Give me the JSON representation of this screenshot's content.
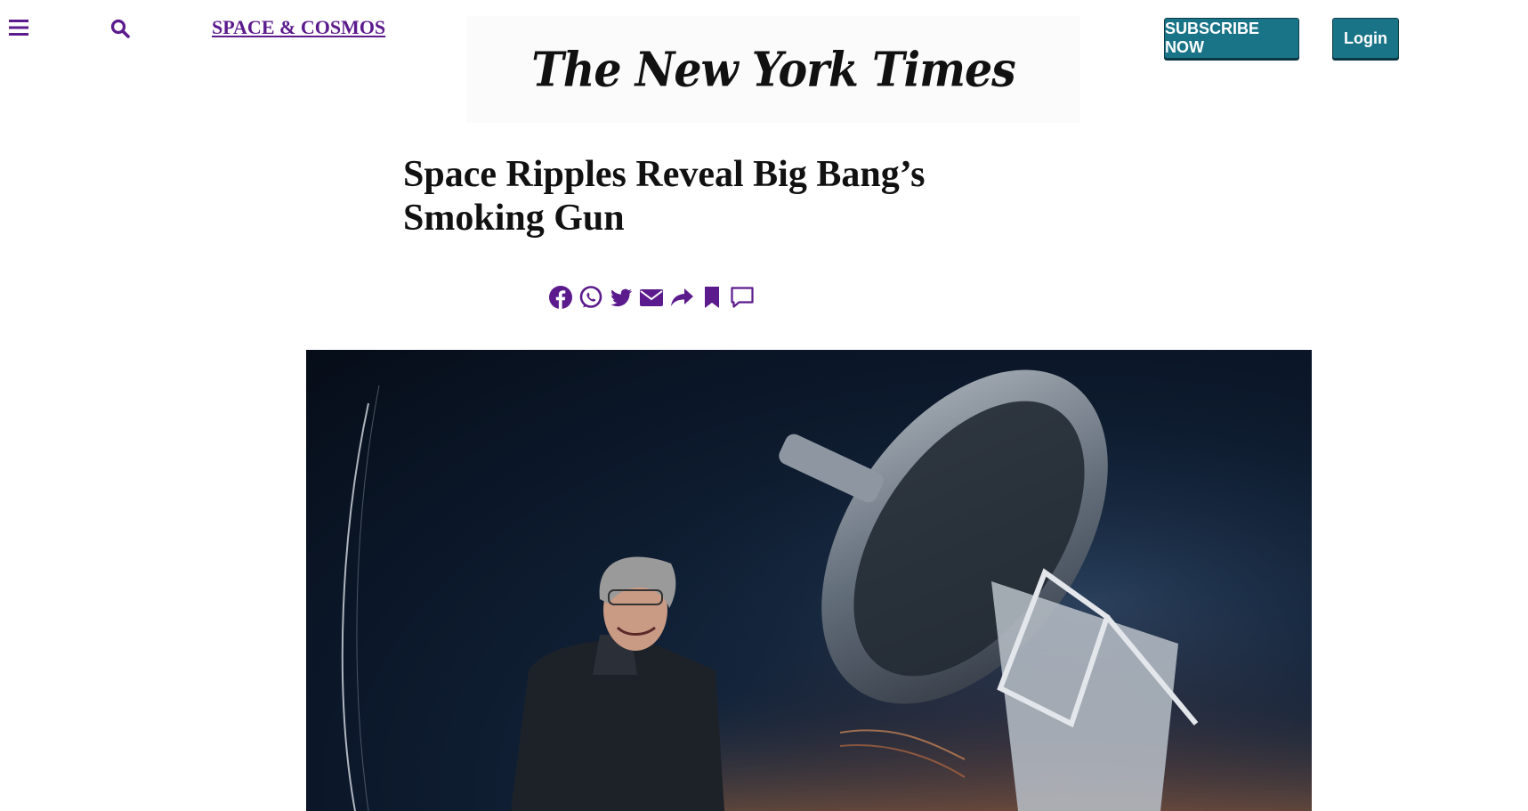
{
  "nav": {
    "menu_icon": "hamburger-menu-icon",
    "search_icon": "search-icon",
    "section_label": "SPACE & COSMOS"
  },
  "masthead": {
    "title": "The New York Times"
  },
  "actions": {
    "subscribe_label": "SUBSCRIBE NOW",
    "login_label": "Login"
  },
  "article": {
    "headline": "Space Ripples Reveal Big Bang’s Smoking Gun"
  },
  "share_icons": [
    "facebook-icon",
    "whatsapp-icon",
    "twitter-icon",
    "email-icon",
    "share-icon",
    "bookmark-icon",
    "comment-icon"
  ],
  "colors": {
    "accent_purple": "#5b1b8d",
    "button_teal": "#1a7487",
    "text": "#111111"
  }
}
